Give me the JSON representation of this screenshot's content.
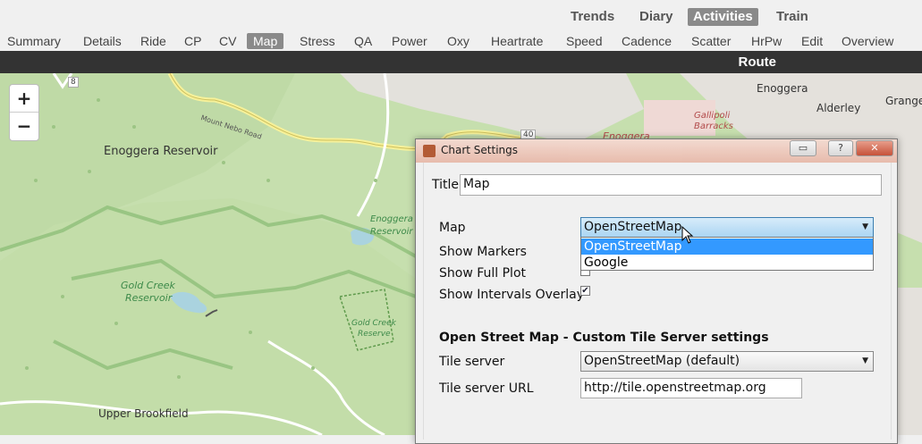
{
  "views": [
    "Trends",
    "Diary",
    "Activities",
    "Train"
  ],
  "active_view": "Activities",
  "tabs": [
    "Summary",
    "Details",
    "Ride",
    "CP",
    "CV",
    "Map",
    "Stress",
    "QA",
    "Power",
    "Oxy",
    "Heartrate",
    "Speed",
    "Cadence",
    "Scatter",
    "HrPw",
    "Edit",
    "Overview"
  ],
  "active_tab": "Map",
  "chart_title": "Route",
  "map": {
    "zoom_in": "+",
    "zoom_out": "−",
    "labels": {
      "enoggera_reservoir": "Enoggera Reservoir",
      "enoggera": "Enoggera",
      "enoggera_right": "Enoggera",
      "alderley": "Alderley",
      "grange": "Grange",
      "gallipoli": "Gallipoli",
      "barracks": "Barracks",
      "mount_nebo_road": "Mount Nebo Road",
      "enoggera_reservoir_small_1": "Enoggera",
      "enoggera_reservoir_small_2": "Reservoir",
      "gold_creek_reservoir_1": "Gold Creek",
      "gold_creek_reservoir_2": "Reservoir",
      "gold_creek_reserve_1": "Gold Creek",
      "gold_creek_reserve_2": "Reserve",
      "upper_brookfield": "Upper Brookfield",
      "road_8": "8",
      "road_40": "40"
    }
  },
  "dialog": {
    "title": "Chart Settings",
    "title_label": "Title",
    "title_value": "Map",
    "map_label": "Map",
    "map_selected": "OpenStreetMap",
    "map_options": [
      "OpenStreetMap",
      "Google"
    ],
    "show_markers": "Show Markers",
    "show_full_plot": "Show Full Plot",
    "show_intervals": "Show Intervals Overlay",
    "section_heading": "Open Street Map - Custom Tile Server settings",
    "tile_server_label": "Tile server",
    "tile_server_value": "OpenStreetMap (default)",
    "tile_url_label": "Tile server URL",
    "tile_url_value": "http://tile.openstreetmap.org",
    "buttons": {
      "context": "",
      "help": "?",
      "close": "✕"
    }
  }
}
